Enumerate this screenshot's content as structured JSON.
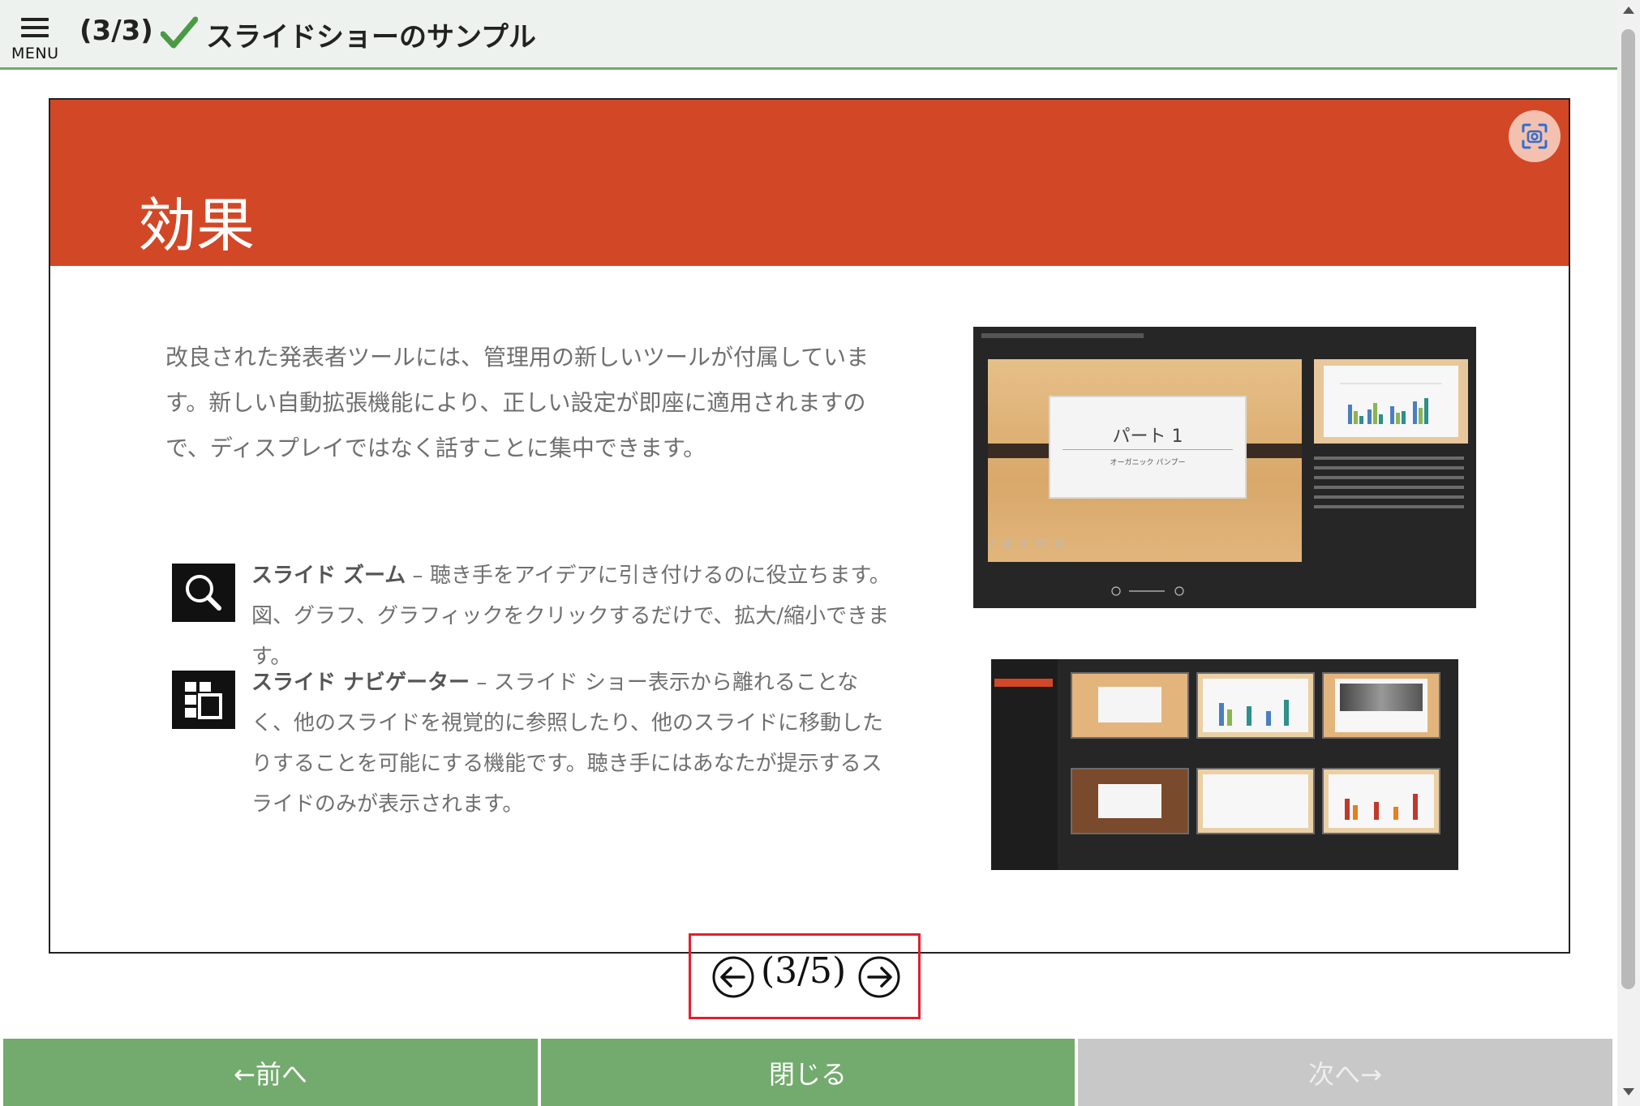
{
  "header": {
    "menu_label": "MENU",
    "page_counter": "(3/3)",
    "title": "スライドショーのサンプル",
    "check_color": "#4a9a45",
    "border_color": "#72ab6d"
  },
  "slide": {
    "title": "効果",
    "banner_color": "#d24726",
    "intro": "改良された発表者ツールには、管理用の新しいツールが付属しています。新しい自動拡張機能により、正しい設定が即座に適用されますので、ディスプレイではなく話すことに集中できます。",
    "features": [
      {
        "heading": "スライド ズーム",
        "separator": " – ",
        "description": "聴き手をアイデアに引き付けるのに役立ちます。図、グラフ、グラフィックをクリックするだけで、拡大/縮小できます。",
        "icon": "magnifier-icon"
      },
      {
        "heading": "スライド ナビゲーター",
        "separator": " – ",
        "description": "スライド ショー表示から離れることなく、他のスライドを視覚的に参照したり、他のスライドに移動したりすることを可能にする機能です。聴き手にはあなたが提示するスライドのみが表示されます。",
        "icon": "slide-grid-icon"
      }
    ],
    "presenter_shot": {
      "card_title": "パート 1",
      "card_sub": "オーガニック パンプー"
    }
  },
  "pager": {
    "label": "(3/5)",
    "highlight_color": "#e0202f"
  },
  "footer": {
    "prev_label": "←前へ",
    "close_label": "閉じる",
    "next_label": "次へ→",
    "active_color": "#72ab6d",
    "disabled_color": "#c8c8c8"
  }
}
